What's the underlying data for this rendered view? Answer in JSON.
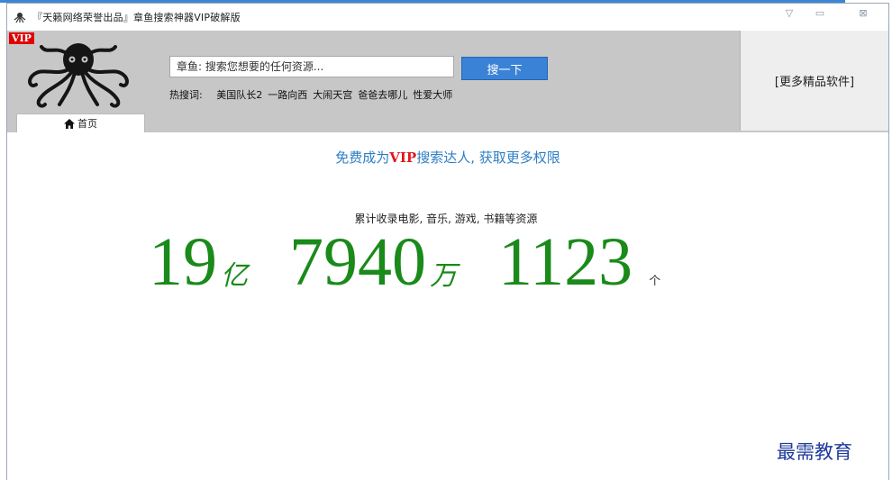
{
  "window": {
    "title": "『天籁网络荣誉出品』章鱼搜索神器VIP破解版",
    "controls": {
      "minimize": "▽",
      "maximize": "▭",
      "close": "⊠"
    }
  },
  "header": {
    "vip_badge": "VIP",
    "home_tab": "首页",
    "search": {
      "value": "章鱼: 搜索您想要的任何资源...",
      "button": "搜一下"
    },
    "hot": {
      "label": "热搜词:",
      "items": [
        "美国队长2",
        "一路向西",
        "大闹天宫",
        "爸爸去哪儿",
        "性爱大师"
      ]
    },
    "more_software": "[更多精品软件]"
  },
  "main": {
    "vip_banner": {
      "prefix": "免费成为",
      "vip": "VIP",
      "suffix": "搜索达人, 获取更多权限"
    },
    "stats_caption": "累计收录电影, 音乐, 游戏, 书籍等资源",
    "count": {
      "billions": "19",
      "unit_billion": "亿",
      "tenthousands": "7940",
      "unit_tenthousand": "万",
      "ones": "1123",
      "unit_item": "个"
    }
  },
  "watermark": "最需教育",
  "colors": {
    "accent_blue": "#3a82d6",
    "count_green": "#1a8a1a",
    "vip_red": "#e01818",
    "banner_blue": "#2d7ec4"
  },
  "icons": [
    "app-icon",
    "octopus-logo",
    "home-icon"
  ]
}
